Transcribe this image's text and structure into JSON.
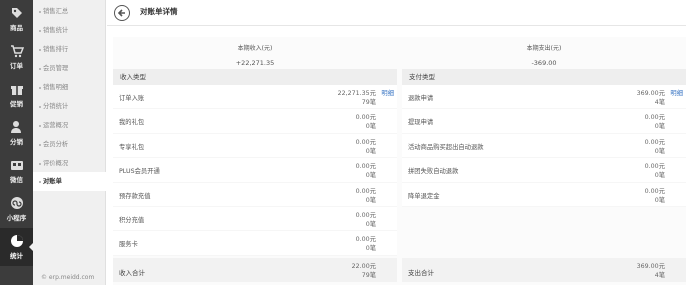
{
  "rail": {
    "items": [
      {
        "label": "商品",
        "icon": "tag-icon"
      },
      {
        "label": "订单",
        "icon": "cart-icon"
      },
      {
        "label": "促销",
        "icon": "gift-icon"
      },
      {
        "label": "分销",
        "icon": "user-icon"
      },
      {
        "label": "微信",
        "icon": "wechat-icon"
      },
      {
        "label": "小程序",
        "icon": "miniprogram-icon"
      },
      {
        "label": "统计",
        "icon": "piechart-icon"
      }
    ]
  },
  "subnav": {
    "items": [
      "销售汇总",
      "销售统计",
      "销售排行",
      "会员管理",
      "销售明细",
      "分销统计",
      "运营概况",
      "会员分析",
      "评价概况",
      "对账单"
    ],
    "footer": "© erp.meidd.com"
  },
  "header": {
    "title": "对账单详情"
  },
  "summary": {
    "income_label": "本期收入(元)",
    "income_value": "+22,271.35",
    "expense_label": "本期支出(元)",
    "expense_value": "-369.00"
  },
  "income": {
    "header": "收入类型",
    "rows": [
      {
        "name": "订单入账",
        "amount": "22,271.35元",
        "count": "79笔",
        "link": "明细"
      },
      {
        "name": "我的礼包",
        "amount": "0.00元",
        "count": "0笔",
        "link": ""
      },
      {
        "name": "专享礼包",
        "amount": "0.00元",
        "count": "0笔",
        "link": ""
      },
      {
        "name": "PLUS会员开通",
        "amount": "0.00元",
        "count": "0笔",
        "link": ""
      },
      {
        "name": "预存款充值",
        "amount": "0.00元",
        "count": "0笔",
        "link": ""
      },
      {
        "name": "积分充值",
        "amount": "0.00元",
        "count": "0笔",
        "link": ""
      },
      {
        "name": "服务卡",
        "amount": "0.00元",
        "count": "0笔",
        "link": ""
      }
    ],
    "total_label": "收入合计",
    "total_amount": "22.00元",
    "total_count": "79笔"
  },
  "expense": {
    "header": "支付类型",
    "rows": [
      {
        "name": "退款申请",
        "amount": "369.00元",
        "count": "4笔",
        "link": "明细"
      },
      {
        "name": "提现申请",
        "amount": "0.00元",
        "count": "0笔",
        "link": ""
      },
      {
        "name": "活动商品购买超出自动退款",
        "amount": "0.00元",
        "count": "0笔",
        "link": ""
      },
      {
        "name": "拼团失败自动退款",
        "amount": "0.00元",
        "count": "0笔",
        "link": ""
      },
      {
        "name": "降单退定金",
        "amount": "0.00元",
        "count": "0笔",
        "link": ""
      }
    ],
    "total_label": "支出合计",
    "total_amount": "369.00元",
    "total_count": "4笔"
  },
  "colors": {
    "rail_bg": "#3c3c3c",
    "link": "#3a76c4",
    "subnav_bg": "#f0f0f0"
  }
}
